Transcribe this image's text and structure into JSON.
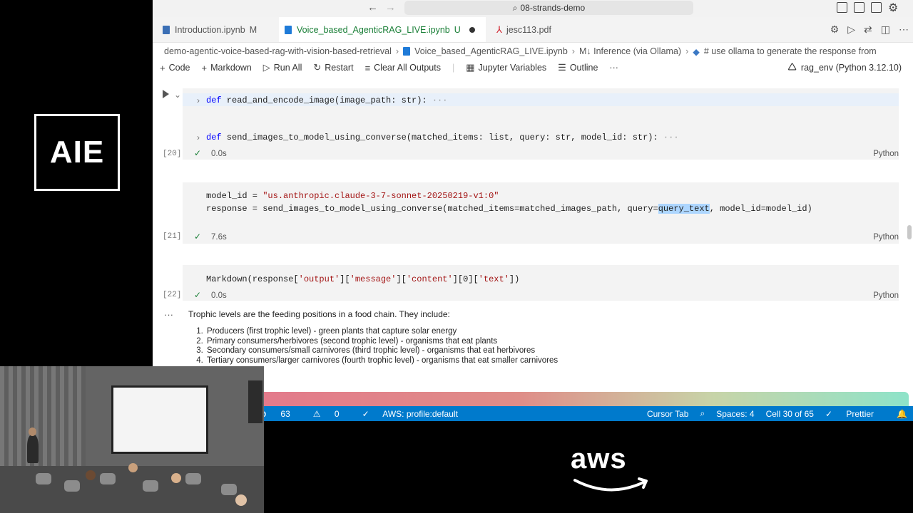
{
  "brand": {
    "conference_logo": "AIE",
    "sponsor_logo": "aws"
  },
  "window": {
    "title": "08-strands-demo"
  },
  "tabs": [
    {
      "label": "Introduction.ipynb",
      "status": "M"
    },
    {
      "label": "Voice_based_AgenticRAG_LIVE.ipynb",
      "status": "U"
    },
    {
      "label": "jesc113.pdf",
      "status": ""
    }
  ],
  "breadcrumb": [
    "demo-agentic-voice-based-rag-with-vision-based-retrieval",
    "Voice_based_AgenticRAG_LIVE.ipynb",
    "M↓ Inference (via Ollama)",
    "# use ollama to generate the response from"
  ],
  "toolbar": {
    "code": "Code",
    "markdown": "Markdown",
    "run_all": "Run All",
    "restart": "Restart",
    "clear_outputs": "Clear All Outputs",
    "jupyter_variables": "Jupyter Variables",
    "outline": "Outline",
    "more": "···",
    "kernel": "rag_env (Python 3.12.10)"
  },
  "cells": {
    "c20": {
      "count": "[20]",
      "fn1": {
        "kw": "def",
        "rest": " read_and_encode_image(image_path: str):",
        "ellipsis": "···"
      },
      "fn2": {
        "kw": "def",
        "rest": " send_images_to_model_using_converse(matched_items: list, query: str, model_id: str):",
        "ellipsis": "···"
      },
      "time": "0.0s",
      "lang": "Python"
    },
    "c21": {
      "count": "[21]",
      "line1_a": "model_id = ",
      "line1_str": "\"us.anthropic.claude-3-7-sonnet-20250219-v1:0\"",
      "line2_a": "response = send_images_to_model_using_converse(matched_items=matched_images_path, query=",
      "line2_sel": "query_text",
      "line2_b": ", model_id=model_id)",
      "time": "7.6s",
      "lang": "Python"
    },
    "c22": {
      "count": "[22]",
      "code_pre": "Markdown(response[",
      "s1": "'output'",
      "mid1": "][",
      "s2": "'message'",
      "mid2": "][",
      "s3": "'content'",
      "mid3": "][0][",
      "s4": "'text'",
      "code_post": "])",
      "time": "0.0s",
      "lang": "Python"
    }
  },
  "output": {
    "dots": "···",
    "intro": "Trophic levels are the feeding positions in a food chain. They include:",
    "items": [
      "Producers (first trophic level) - green plants that capture solar energy",
      "Primary consumers/herbivores (second trophic level) - organisms that eat plants",
      "Secondary consumers/small carnivores (third trophic level) - organisms that eat herbivores",
      "Tertiary consumers/larger carnivores (fourth trophic level) - organisms that eat smaller carnivores"
    ]
  },
  "statusbar": {
    "errors": "63",
    "warnings": "0",
    "aws": "AWS: profile:default",
    "cursor_tab": "Cursor Tab",
    "spaces": "Spaces: 4",
    "cell": "Cell 30 of 65",
    "prettier": "Prettier"
  }
}
